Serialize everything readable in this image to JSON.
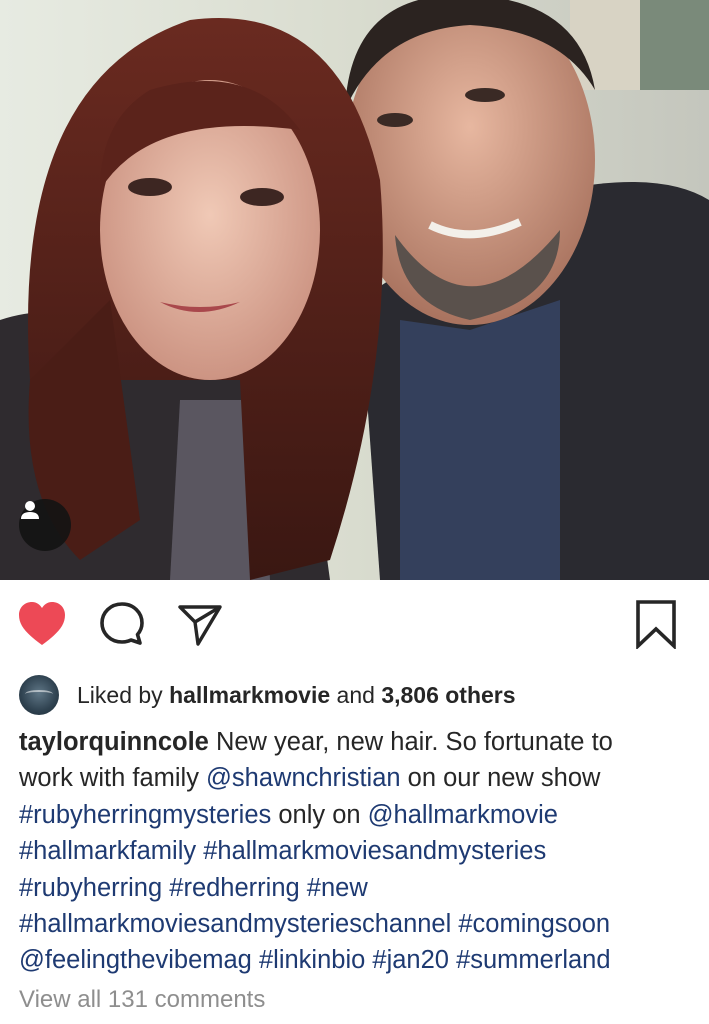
{
  "post": {
    "photo_alt_icon": "person-tag-icon",
    "actions": {
      "like_icon": "heart-filled-icon",
      "comment_icon": "comment-icon",
      "share_icon": "direct-send-icon",
      "save_icon": "bookmark-icon",
      "like_color": "#ed4956"
    },
    "likes": {
      "prefix": "Liked by",
      "user": "hallmarkmovie",
      "joiner": "and",
      "others": "3,806 others"
    },
    "caption": {
      "username": "taylorquinncole",
      "line1_text": " New year, new hair. So fortunate to",
      "line2_text": "work with family ",
      "mention_shawn": "@shawnchristian",
      "line2_tail": " on our new show",
      "tag_ruby_mysteries": "#rubyherringmysteries",
      "line3_mid": " only on ",
      "mention_hallmark": "@hallmarkmovie",
      "tag_hallmarkfamily": "#hallmarkfamily",
      "tag_hmm": "#hallmarkmoviesandmysteries",
      "tag_rubyherring": "#rubyherring",
      "tag_redherring": "#redherring",
      "tag_new": "#new",
      "tag_hmm_channel": "#hallmarkmoviesandmysterieschannel",
      "tag_comingsoon": "#comingsoon",
      "mention_feeling": "@feelingthevibemag",
      "tag_linkinbio": "#linkinbio",
      "tag_jan20": "#jan20",
      "tag_summerland": "#summerland"
    },
    "view_comments": "View all 131 comments",
    "link_color": "#1e3a72"
  }
}
